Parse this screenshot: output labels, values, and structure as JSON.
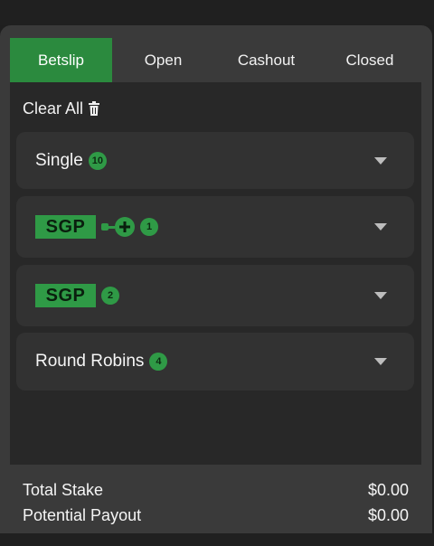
{
  "tabs": [
    {
      "label": "Betslip",
      "active": true
    },
    {
      "label": "Open",
      "active": false
    },
    {
      "label": "Cashout",
      "active": false
    },
    {
      "label": "Closed",
      "active": false
    }
  ],
  "clear_all": {
    "label": "Clear All",
    "icon": "trash-icon"
  },
  "sections": [
    {
      "label": "Single",
      "count": "10"
    },
    {
      "label": "SGP",
      "count": "1",
      "icon": "plus-link-icon"
    },
    {
      "label": "SGP",
      "count": "2"
    },
    {
      "label": "Round Robins",
      "count": "4"
    }
  ],
  "footer": {
    "total_stake_label": "Total Stake",
    "total_stake_value": "$0.00",
    "potential_payout_label": "Potential Payout",
    "potential_payout_value": "$0.00"
  },
  "colors": {
    "accent": "#2f9a46",
    "panel": "#3a3a3a",
    "card": "#323232"
  }
}
